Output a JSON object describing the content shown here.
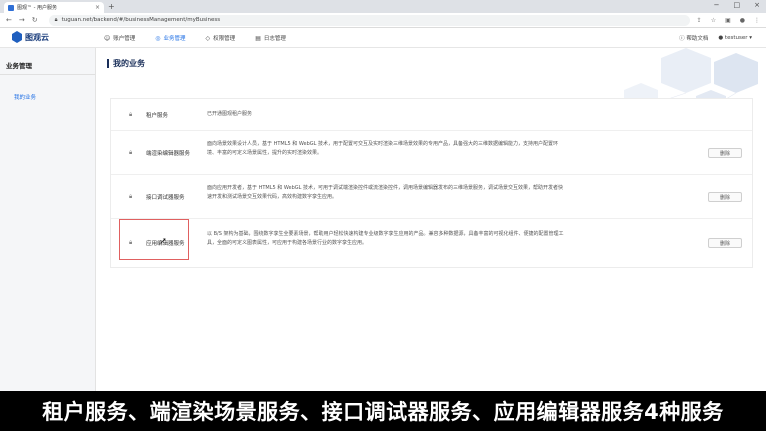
{
  "browser": {
    "tab_title": "图观™ - 用户服务",
    "tab_close": "×",
    "new_tab": "+",
    "url": "tuguan.net/backend/#/businessManagement/myBusiness",
    "window_controls": [
      "−",
      "□",
      "×"
    ]
  },
  "app": {
    "logo_text": "图观云",
    "menu": [
      {
        "label": "账户管理",
        "icon": "person-icon"
      },
      {
        "label": "业务管理",
        "icon": "briefcase-icon",
        "active": true
      },
      {
        "label": "权限管理",
        "icon": "shield-icon"
      },
      {
        "label": "日志管理",
        "icon": "log-icon"
      }
    ],
    "help_label": "帮助文档",
    "username": "testuser"
  },
  "sidebar": {
    "title": "业务管理",
    "items": [
      {
        "label": "我的业务",
        "active": true
      }
    ]
  },
  "main": {
    "title": "我的业务",
    "services": [
      {
        "name": "租户服务",
        "description": "已开通图观租户服务",
        "action": ""
      },
      {
        "name": "端渲染编辑器服务",
        "description": "面向场景效果设计人员，基于 HTML5 和 WebGL 技术，用于配置可交互及实时渲染三维场景效果的专用产品，具备强大的三维数据编辑能力，支持用户配置环境、丰富的可定义场景属性，提升的实时渲染效果。",
        "action": "删除"
      },
      {
        "name": "接口调试器服务",
        "description": "面向应用开发者，基于 HTML5 和 WebGL 技术，可用于调试端渲染控件或流渲染控件，调用场景编辑器发布的三维场景服务，调试场景交互效果，帮助开发者快速开发和测试场景交互效果代码，高效构建数字孪生应用。",
        "action": "删除"
      },
      {
        "name": "应用编辑器服务",
        "description": "以 B/S 架构为基础，围绕数字孪生全要素场景，帮助用户轻松快速构建专业级数字孪生应用的产品。兼容多种数据源，具备丰富的可视化组件、便捷的配置管理工具，全面的可定义图表属性，可应用于构建各场景行业的数字孪生应用。",
        "action": "删除"
      }
    ]
  },
  "caption": "租户服务、端渲染场景服务、接口调试器服务、应用编辑器服务4种服务"
}
